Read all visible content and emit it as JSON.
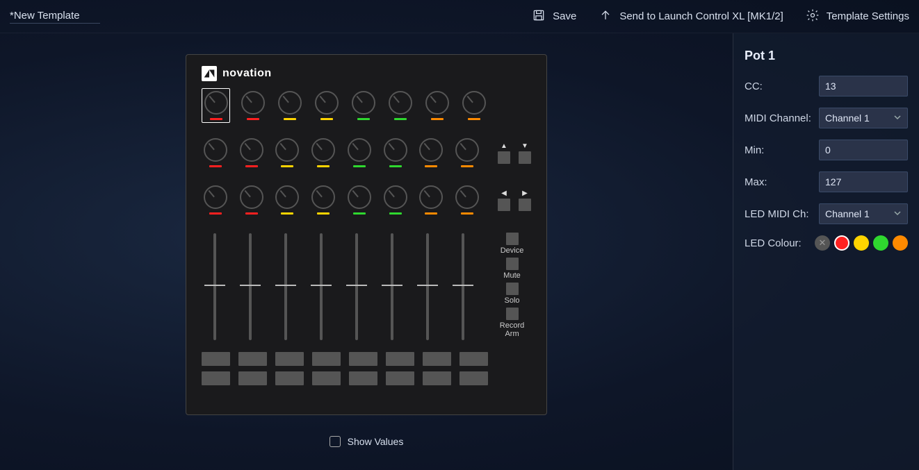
{
  "topbar": {
    "template_name": "*New Template",
    "save": "Save",
    "send": "Send to Launch Control XL [MK1/2]",
    "settings": "Template Settings"
  },
  "device": {
    "brand": "novation",
    "knob_rows": 3,
    "knobs_per_row": 8,
    "led_colors": [
      "red",
      "red",
      "yellow",
      "yellow",
      "green",
      "green",
      "orange",
      "orange"
    ],
    "selected_row": 0,
    "selected_col": 0,
    "arrow_up": "▲",
    "arrow_down": "▼",
    "arrow_left": "◀",
    "arrow_right": "▶",
    "side_labels": [
      "Device",
      "Mute",
      "Solo",
      "Record Arm"
    ],
    "faders": 8,
    "button_rows": 2,
    "buttons_per_row": 8
  },
  "show_values_label": "Show Values",
  "sidebar": {
    "title": "Pot 1",
    "cc_label": "CC:",
    "cc_value": "13",
    "midi_ch_label": "MIDI Channel:",
    "midi_ch_value": "Channel 1",
    "min_label": "Min:",
    "min_value": "0",
    "max_label": "Max:",
    "max_value": "127",
    "led_midi_label": "LED MIDI Ch:",
    "led_midi_value": "Channel 1",
    "led_colour_label": "LED Colour:",
    "led_colours": [
      {
        "name": "none",
        "hex": "#555"
      },
      {
        "name": "red",
        "hex": "#ff2020",
        "selected": true
      },
      {
        "name": "yellow",
        "hex": "#ffd400"
      },
      {
        "name": "green",
        "hex": "#2fd82f"
      },
      {
        "name": "orange",
        "hex": "#ff8a00"
      }
    ]
  }
}
